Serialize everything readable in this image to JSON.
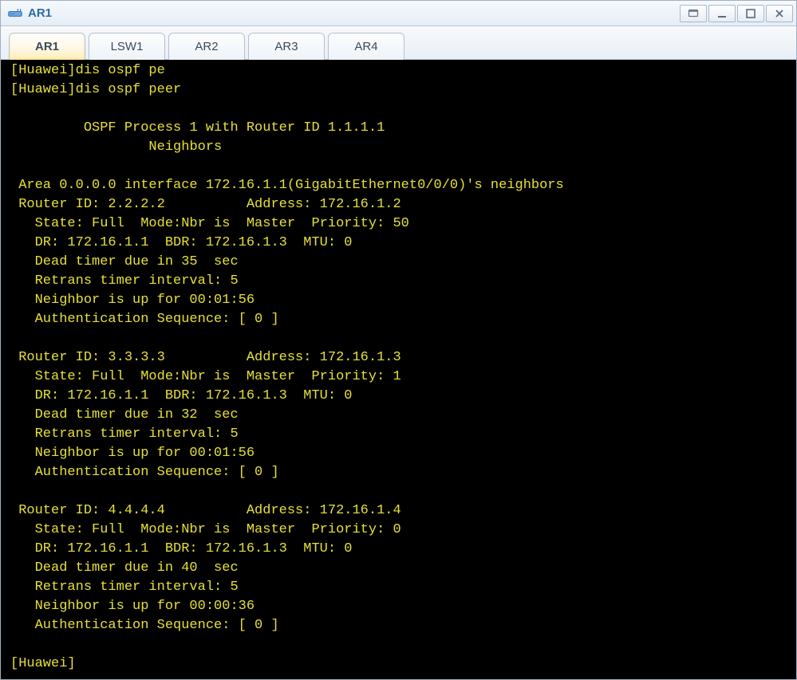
{
  "window": {
    "title": "AR1"
  },
  "tabs": [
    {
      "label": "AR1",
      "active": true
    },
    {
      "label": "LSW1",
      "active": false
    },
    {
      "label": "AR2",
      "active": false
    },
    {
      "label": "AR3",
      "active": false
    },
    {
      "label": "AR4",
      "active": false
    }
  ],
  "terminal": {
    "lines": [
      "[Huawei]dis ospf pe",
      "[Huawei]dis ospf peer",
      "",
      "\t OSPF Process 1 with Router ID 1.1.1.1",
      "\t\t Neighbors",
      "",
      " Area 0.0.0.0 interface 172.16.1.1(GigabitEthernet0/0/0)'s neighbors",
      " Router ID: 2.2.2.2          Address: 172.16.1.2",
      "   State: Full  Mode:Nbr is  Master  Priority: 50",
      "   DR: 172.16.1.1  BDR: 172.16.1.3  MTU: 0",
      "   Dead timer due in 35  sec",
      "   Retrans timer interval: 5",
      "   Neighbor is up for 00:01:56",
      "   Authentication Sequence: [ 0 ]",
      "",
      " Router ID: 3.3.3.3          Address: 172.16.1.3",
      "   State: Full  Mode:Nbr is  Master  Priority: 1",
      "   DR: 172.16.1.1  BDR: 172.16.1.3  MTU: 0",
      "   Dead timer due in 32  sec",
      "   Retrans timer interval: 5",
      "   Neighbor is up for 00:01:56",
      "   Authentication Sequence: [ 0 ]",
      "",
      " Router ID: 4.4.4.4          Address: 172.16.1.4",
      "   State: Full  Mode:Nbr is  Master  Priority: 0",
      "   DR: 172.16.1.1  BDR: 172.16.1.3  MTU: 0",
      "   Dead timer due in 40  sec",
      "   Retrans timer interval: 5",
      "   Neighbor is up for 00:00:36",
      "   Authentication Sequence: [ 0 ]",
      "",
      "[Huawei]"
    ]
  }
}
